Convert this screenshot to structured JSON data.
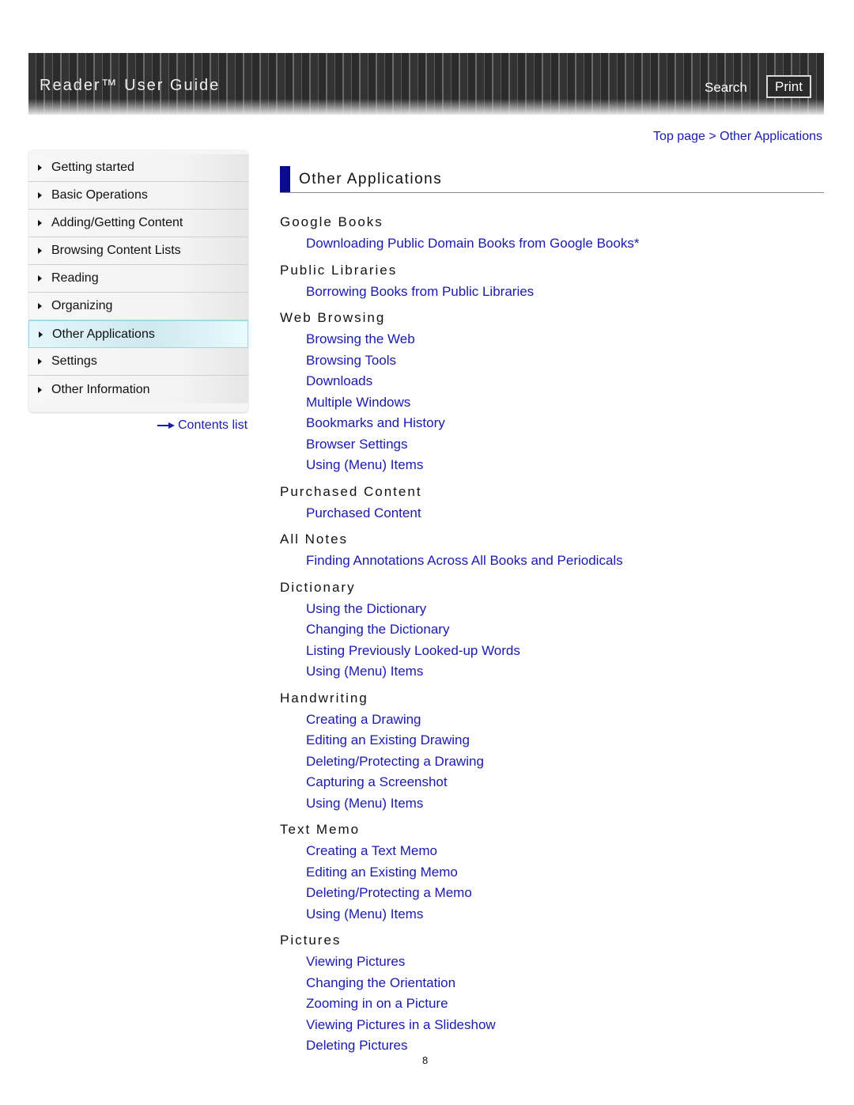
{
  "header": {
    "title": "Reader™ User Guide",
    "search_label": "Search",
    "print_label": "Print"
  },
  "breadcrumb": {
    "items": [
      "Top page",
      "Other Applications"
    ],
    "separator": ">"
  },
  "sidebar": {
    "items": [
      {
        "label": "Getting started",
        "active": false
      },
      {
        "label": "Basic Operations",
        "active": false
      },
      {
        "label": "Adding/Getting Content",
        "active": false
      },
      {
        "label": "Browsing Content Lists",
        "active": false
      },
      {
        "label": "Reading",
        "active": false
      },
      {
        "label": "Organizing",
        "active": false
      },
      {
        "label": "Other Applications",
        "active": true
      },
      {
        "label": "Settings",
        "active": false
      },
      {
        "label": "Other Information",
        "active": false
      }
    ],
    "contents_list_label": "Contents list"
  },
  "main": {
    "title": "Other Applications",
    "sections": [
      {
        "heading": "Google Books",
        "links": [
          "Downloading Public Domain Books from Google Books*"
        ]
      },
      {
        "heading": "Public Libraries",
        "links": [
          "Borrowing Books from Public Libraries"
        ]
      },
      {
        "heading": "Web Browsing",
        "links": [
          "Browsing the Web",
          "Browsing Tools",
          "Downloads",
          "Multiple Windows",
          "Bookmarks and History",
          "Browser Settings",
          "Using (Menu) Items"
        ]
      },
      {
        "heading": "Purchased Content",
        "links": [
          "Purchased Content"
        ]
      },
      {
        "heading": "All Notes",
        "links": [
          "Finding Annotations Across All Books and Periodicals"
        ]
      },
      {
        "heading": "Dictionary",
        "links": [
          "Using the Dictionary",
          "Changing the Dictionary",
          "Listing Previously Looked-up Words",
          "Using (Menu) Items"
        ]
      },
      {
        "heading": "Handwriting",
        "links": [
          "Creating a Drawing",
          "Editing an Existing Drawing",
          "Deleting/Protecting a Drawing",
          "Capturing a Screenshot",
          "Using (Menu) Items"
        ]
      },
      {
        "heading": "Text Memo",
        "links": [
          "Creating a Text Memo",
          "Editing an Existing Memo",
          "Deleting/Protecting a Memo",
          "Using (Menu) Items"
        ]
      },
      {
        "heading": "Pictures",
        "links": [
          "Viewing Pictures",
          "Changing the Orientation",
          "Zooming in on a Picture",
          "Viewing Pictures in a Slideshow",
          "Deleting Pictures"
        ]
      }
    ]
  },
  "footer": {
    "page_number": "8"
  },
  "colors": {
    "link": "#1a1ab0",
    "title_bar": "#0a0a8c",
    "active_sidebar": "#d8f1f6",
    "active_sidebar_border": "#8fdcef",
    "banner": "#2f2f2f"
  }
}
